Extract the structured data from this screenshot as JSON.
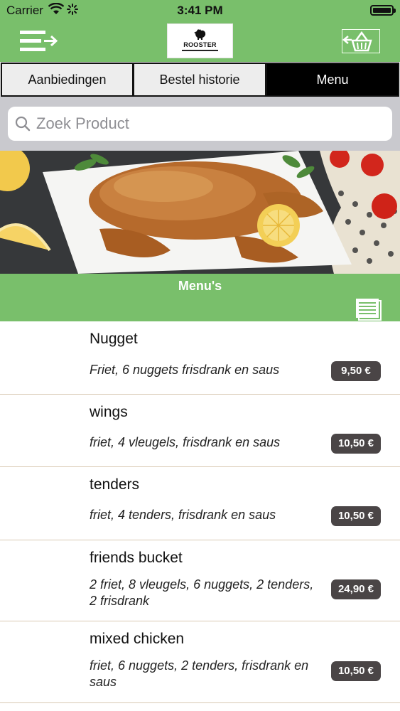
{
  "status_bar": {
    "carrier": "Carrier",
    "time": "3:41 PM"
  },
  "header": {
    "menu_icon": "menu-arrow-icon",
    "logo_text": "ROOSTER",
    "cart_icon": "basket-icon",
    "accent_color": "#79bf6b"
  },
  "tabs": [
    {
      "label": "Aanbiedingen",
      "active": false
    },
    {
      "label": "Bestel historie",
      "active": false
    },
    {
      "label": "Menu",
      "active": true
    }
  ],
  "search": {
    "placeholder": "Zoek Product",
    "value": ""
  },
  "section": {
    "title": "Menu's",
    "list_icon": "list-icon"
  },
  "items": [
    {
      "name": "Nugget",
      "description": "Friet, 6 nuggets frisdrank en saus",
      "price": "9,50 €"
    },
    {
      "name": "wings",
      "description": "friet, 4 vleugels, frisdrank en saus",
      "price": "10,50 €"
    },
    {
      "name": "tenders",
      "description": "friet, 4 tenders, frisdrank en saus",
      "price": "10,50 €"
    },
    {
      "name": "friends bucket",
      "description": "2 friet, 8 vleugels, 6 nuggets, 2 tenders, 2 frisdrank",
      "price": "24,90 €"
    },
    {
      "name": "mixed chicken",
      "description": "friet, 6 nuggets, 2 tenders, frisdrank en saus",
      "price": "10,50 €"
    }
  ],
  "price_badge_color": "#4a4546"
}
